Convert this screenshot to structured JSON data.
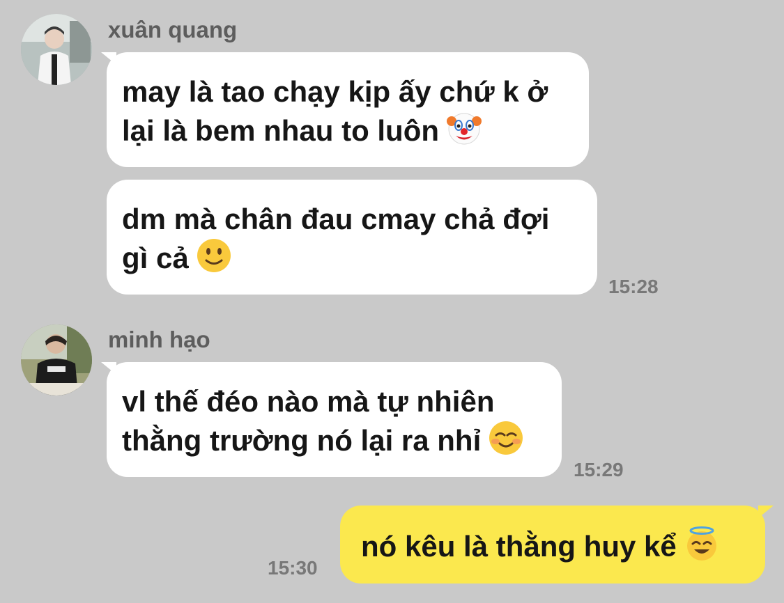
{
  "conversation": {
    "messages": [
      {
        "sender": "xuân quang",
        "text_lines": [
          "may là tao chạy kịp ấy chứ k ở",
          "lại là bem nhau to luôn"
        ],
        "emoji": "clown-face-emoji"
      },
      {
        "text_lines": [
          "dm mà chân đau cmay chả đợi",
          "gì cả"
        ],
        "emoji": "slightly-smiling-face-emoji",
        "time": "15:28"
      },
      {
        "sender": "minh hạo",
        "text_lines": [
          "vl thế đéo nào mà tự nhiên",
          "thằng trường nó lại ra nhỉ"
        ],
        "emoji": "smiling-face-emoji",
        "time": "15:29"
      },
      {
        "outgoing": true,
        "text_lines": [
          "nó kêu là thằng huy kể"
        ],
        "emoji": "halo-face-emoji",
        "time": "15:30"
      }
    ]
  },
  "colors": {
    "background": "#c9c9c9",
    "incoming_bubble": "#ffffff",
    "outgoing_bubble": "#fbe84e",
    "sender_name": "#5d5d5d",
    "timestamp": "#787878"
  }
}
